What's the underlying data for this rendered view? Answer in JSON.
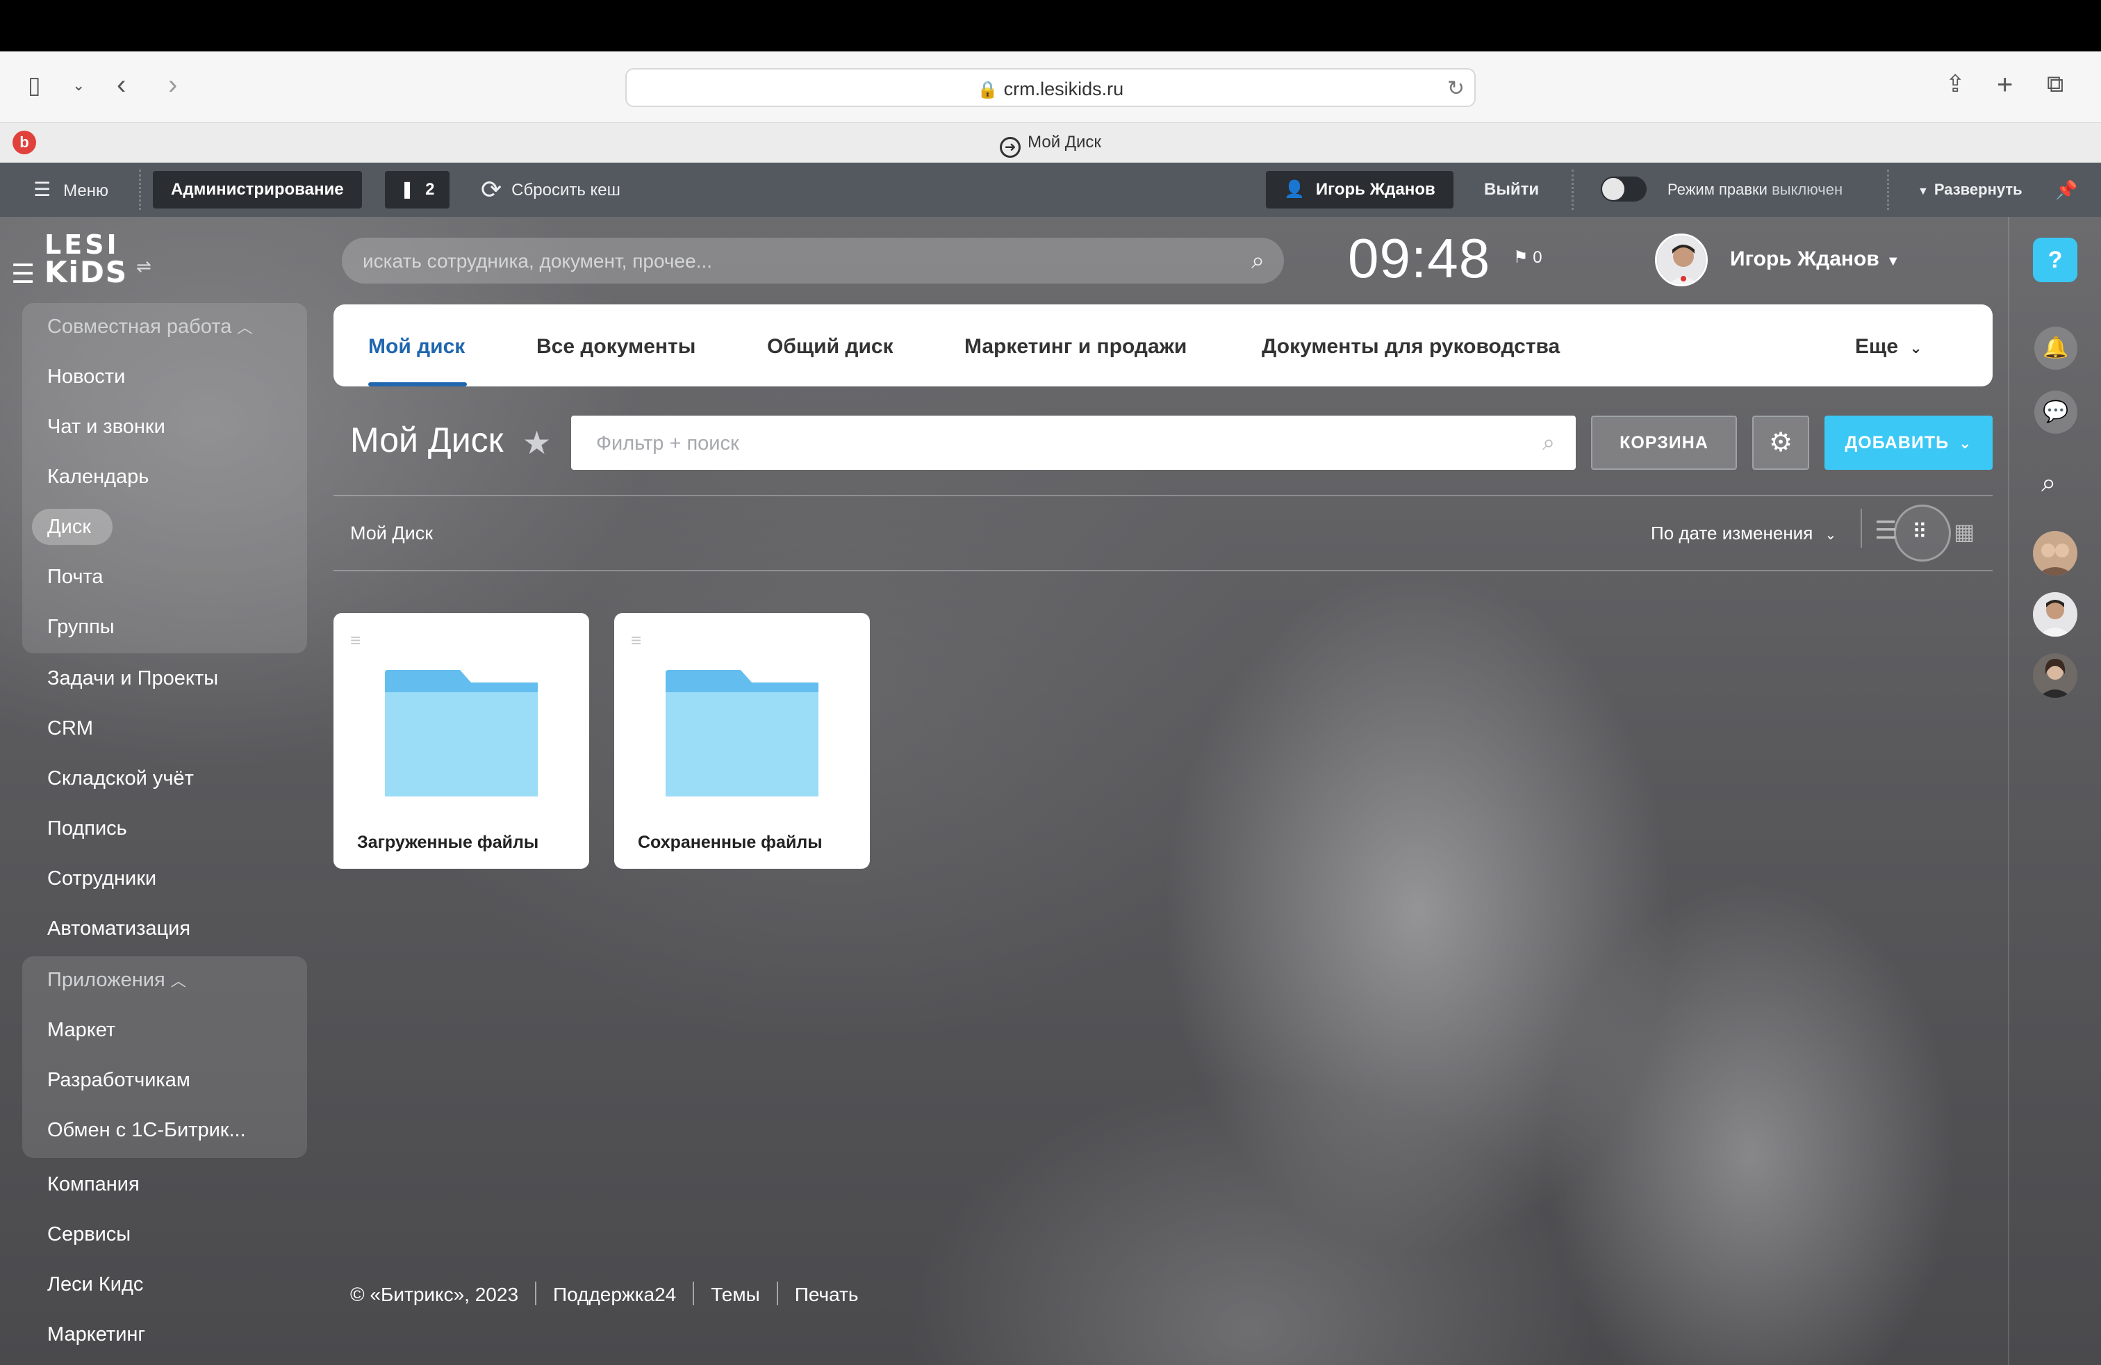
{
  "browser": {
    "url": "crm.lesikids.ru",
    "tab_title": "Мой Диск"
  },
  "admin_bar": {
    "menu_label": "Меню",
    "admin_label": "Администрирование",
    "notifications_count": "2",
    "reset_cache_label": "Сбросить кеш",
    "user_label": "Игорь Жданов",
    "logout_label": "Выйти",
    "edit_mode_label": "Режим правки",
    "edit_mode_state": "выключен",
    "expand_label": "Развернуть"
  },
  "logo": {
    "line1": "LESI",
    "line2": "KiDS"
  },
  "sidebar": {
    "group1": {
      "title": "Совместная работа",
      "items": [
        "Новости",
        "Чат и звонки",
        "Календарь",
        "Диск",
        "Почта",
        "Группы"
      ]
    },
    "items_mid": [
      "Задачи и Проекты",
      "CRM",
      "Складской учёт",
      "Подпись",
      "Сотрудники",
      "Автоматизация"
    ],
    "group2": {
      "title": "Приложения",
      "items": [
        "Маркет",
        "Разработчикам",
        "Обмен с 1С-Битрик..."
      ]
    },
    "items_bottom": [
      "Компания",
      "Сервисы",
      "Леси Кидс",
      "Маркетинг"
    ],
    "active_item": "Диск"
  },
  "header": {
    "search_placeholder": "искать сотрудника, документ, прочее...",
    "time": "09:48",
    "flag_count": "0",
    "user_name": "Игорь Жданов"
  },
  "tabs": [
    {
      "label": "Мой диск",
      "active": true
    },
    {
      "label": "Все документы",
      "active": false
    },
    {
      "label": "Общий диск",
      "active": false
    },
    {
      "label": "Маркетинг и продажи",
      "active": false
    },
    {
      "label": "Документы для руководства",
      "active": false
    }
  ],
  "tabs_more": "Еще",
  "main": {
    "title": "Мой Диск",
    "filter_placeholder": "Фильтр + поиск",
    "trash_label": "КОРЗИНА",
    "add_label": "ДОБАВИТЬ",
    "breadcrumb": "Мой Диск",
    "sort_label": "По дате изменения",
    "folders": [
      {
        "name": "Загруженные файлы"
      },
      {
        "name": "Сохраненные файлы"
      }
    ]
  },
  "footer": {
    "copyright": "© «Битрикс», 2023",
    "links": [
      "Поддержка24",
      "Темы",
      "Печать"
    ]
  },
  "colors": {
    "accent": "#3bc8f5",
    "tab_active": "#2067b0",
    "folder_light": "#9bdcf7",
    "folder_dark": "#63bdef",
    "admin_bar": "#54595f"
  }
}
